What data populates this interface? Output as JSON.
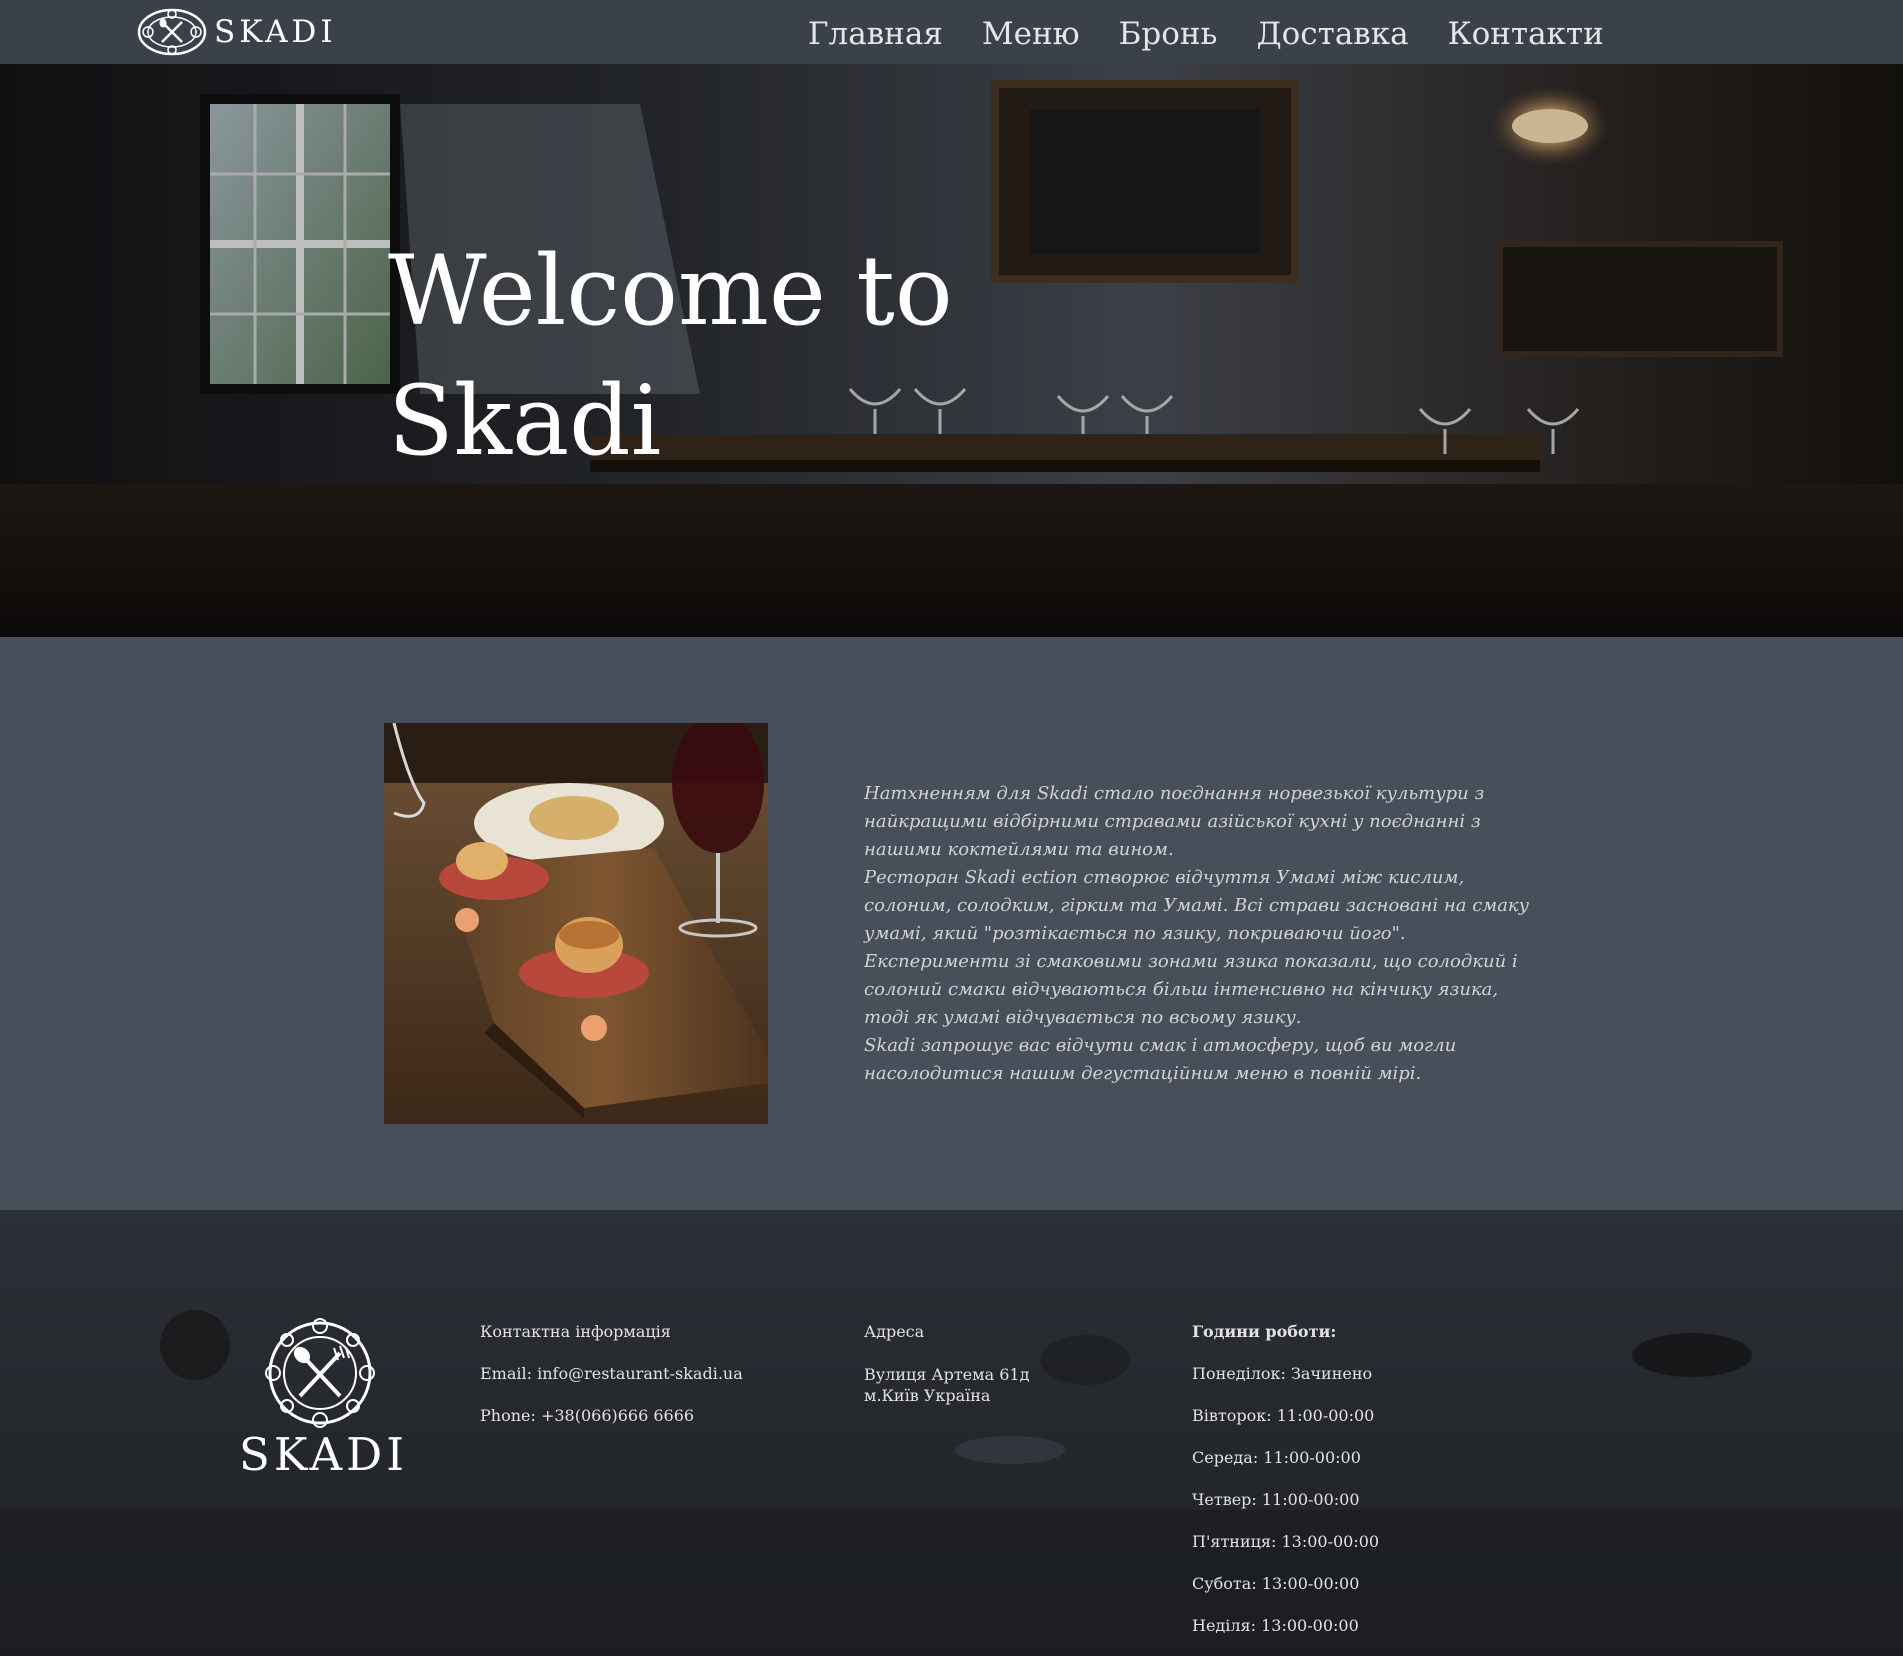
{
  "brand": {
    "name": "SKADI"
  },
  "nav": {
    "items": [
      "Главная",
      "Меню",
      "Бронь",
      "Доставка",
      "Контакти"
    ]
  },
  "hero": {
    "title_line1": "Welcome to",
    "title_line2": "Skadi"
  },
  "about": {
    "paragraphs": [
      "Натхненням для Skadi стало поєднання норвезької культури з найкращими відбірними стравами азійської кухні у поєднанні з нашими коктейлями та вином.",
      "Ресторан Skadi ection створює відчуття Умамі між кислим, солоним, солодким, гірким та Умамі. Всі страви засновані на смаку умамі, який \"розтікається по язику, покриваючи його\".",
      "Експерименти зі смаковими зонами язика показали, що солодкий і солоний смаки відчуваються більш інтенсивно на кінчику язика, тоді як умамі відчувається по всьому язику.",
      "Skadi запрошує вас відчути смак і атмосферу, щоб ви могли насолодитися нашим дегустаційним меню в повній мірі."
    ]
  },
  "footer": {
    "logo_name": "SKADI",
    "contact": {
      "heading": "Контактна інформація",
      "email": "Email: info@restaurant-skadi.ua",
      "phone": "Phone: +38(066)666 6666"
    },
    "address": {
      "heading": "Адреса",
      "line1": "Вулиця Артема 61д",
      "line2": "м.Київ Україна"
    },
    "hours": {
      "heading": "Години роботи:",
      "days": [
        "Понеділок: Зачинено",
        "Вівторок: 11:00-00:00",
        "Середа: 11:00-00:00",
        "Четвер: 11:00-00:00",
        "П'ятниця: 13:00-00:00",
        "Субота: 13:00-00:00",
        "Неділя: 13:00-00:00"
      ]
    }
  },
  "colors": {
    "navbar": "#3b414a",
    "section_bg": "#474f5a",
    "footer_bg": "#262a30",
    "text_light": "#e9e9e9"
  },
  "icons": [
    "skadi-logo-icon",
    "hero-background-image",
    "dish-photo-image",
    "footer-background-image"
  ]
}
